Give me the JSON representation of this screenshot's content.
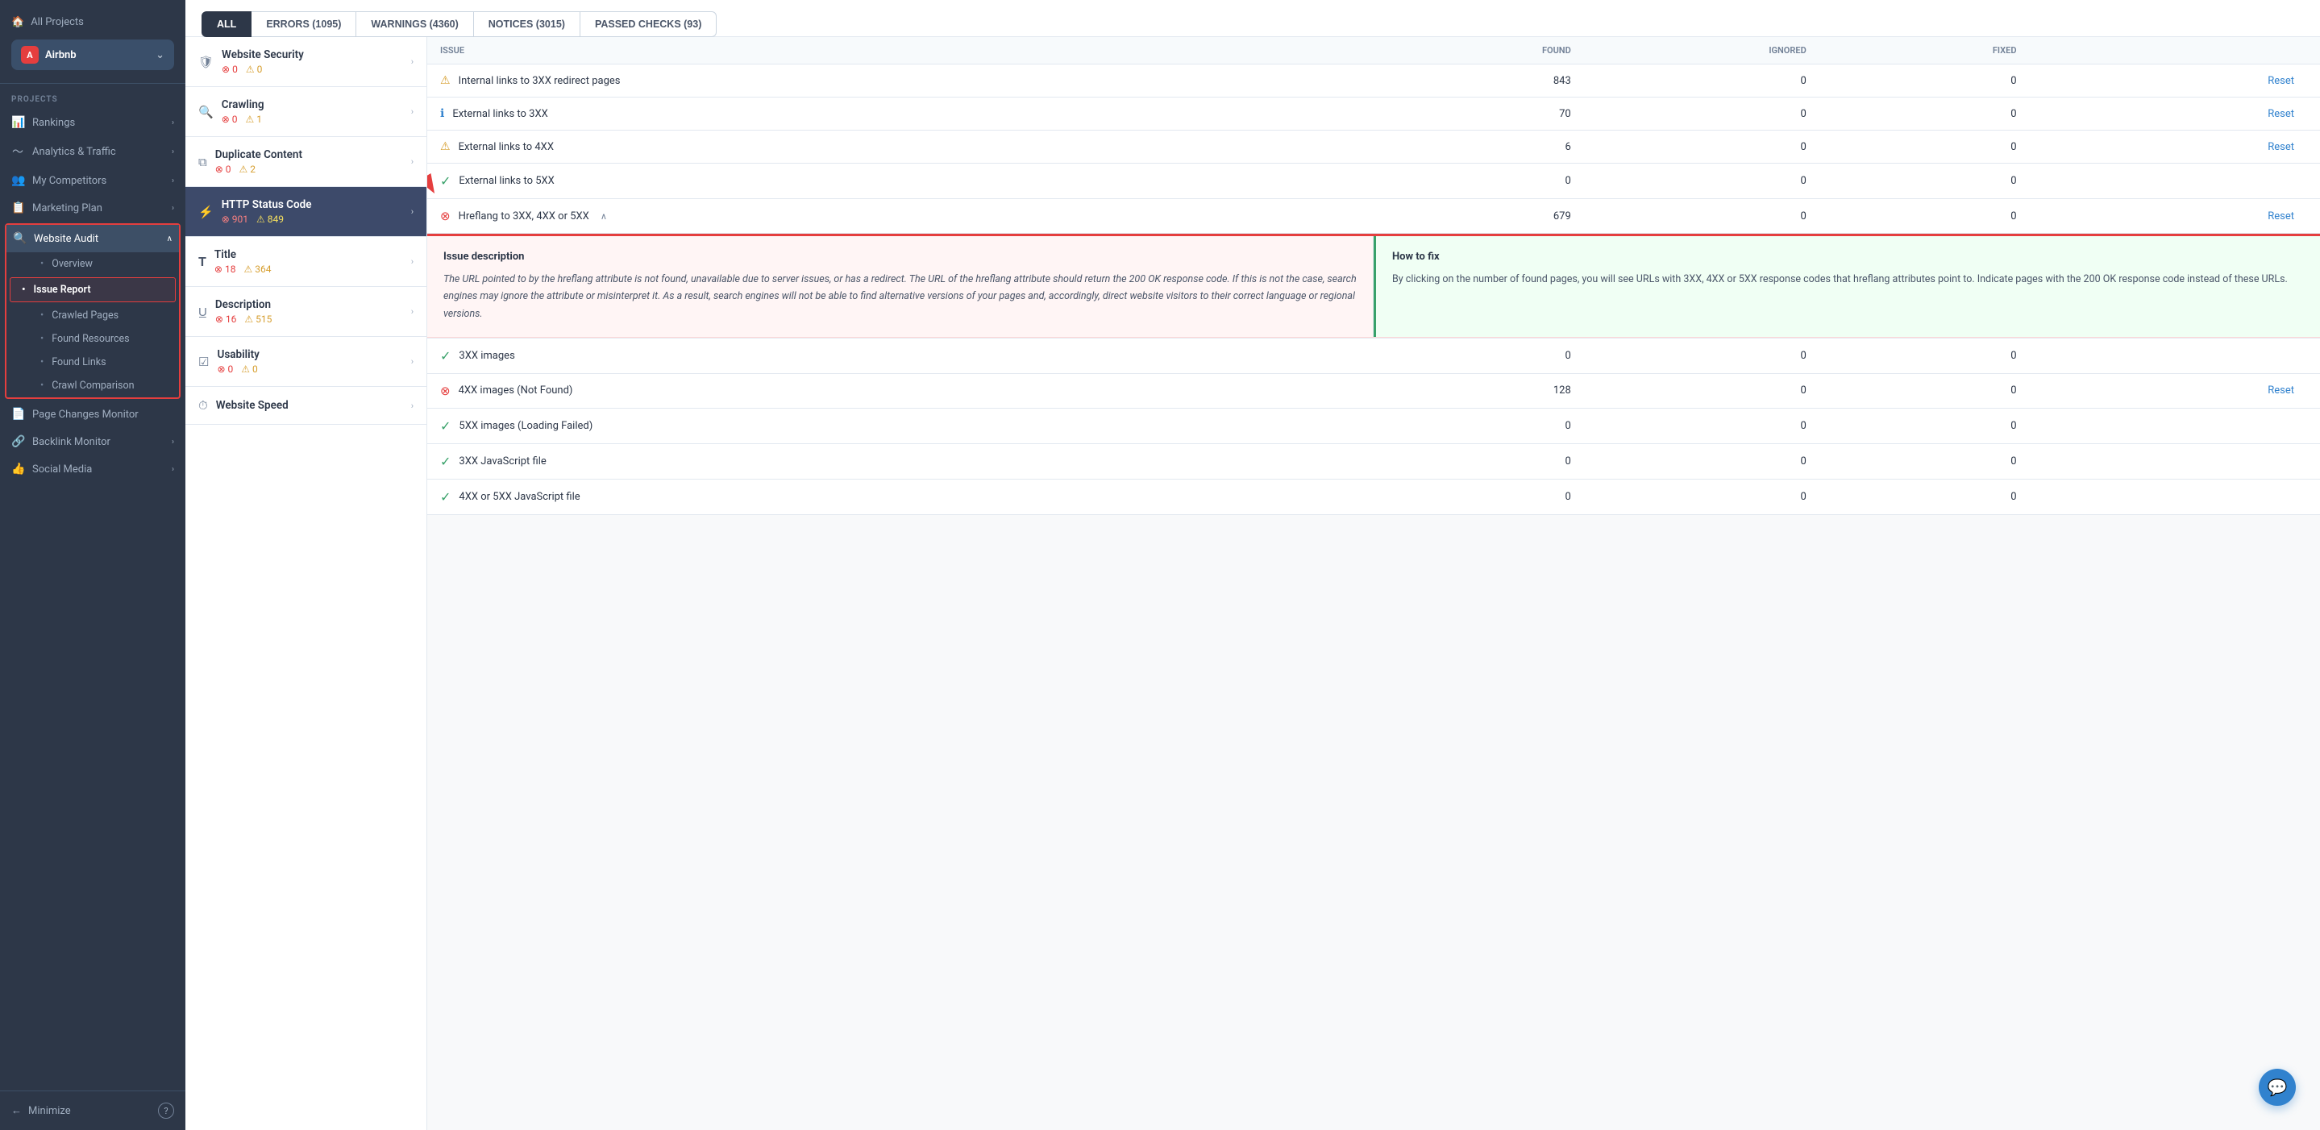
{
  "sidebar": {
    "all_projects_label": "All Projects",
    "project_icon_text": "A",
    "project_name": "Airbnb",
    "projects_section_label": "PROJECTS",
    "nav_items": [
      {
        "id": "rankings",
        "label": "Rankings",
        "icon": "📊",
        "has_chevron": true
      },
      {
        "id": "analytics",
        "label": "Analytics & Traffic",
        "icon": "〜",
        "has_chevron": true
      },
      {
        "id": "competitors",
        "label": "My Competitors",
        "icon": "👥",
        "has_chevron": true
      },
      {
        "id": "marketing",
        "label": "Marketing Plan",
        "icon": "📋",
        "has_chevron": true
      },
      {
        "id": "website-audit",
        "label": "Website Audit",
        "icon": "🔍",
        "has_chevron": true,
        "active": true
      }
    ],
    "sub_items": [
      {
        "id": "overview",
        "label": "Overview",
        "active": false
      },
      {
        "id": "issue-report",
        "label": "Issue Report",
        "active": true
      },
      {
        "id": "crawled-pages",
        "label": "Crawled Pages",
        "active": false
      },
      {
        "id": "found-resources",
        "label": "Found Resources",
        "active": false
      },
      {
        "id": "found-links",
        "label": "Found Links",
        "active": false
      },
      {
        "id": "crawl-comparison",
        "label": "Crawl Comparison",
        "active": false
      }
    ],
    "bottom_items": [
      {
        "id": "page-changes",
        "label": "Page Changes Monitor",
        "icon": "📄"
      },
      {
        "id": "backlink",
        "label": "Backlink Monitor",
        "icon": "🔗",
        "has_chevron": true
      },
      {
        "id": "social",
        "label": "Social Media",
        "icon": "👍",
        "has_chevron": true
      }
    ],
    "minimize_label": "Minimize",
    "help_icon": "?"
  },
  "filter_tabs": [
    {
      "id": "all",
      "label": "ALL",
      "active": true
    },
    {
      "id": "errors",
      "label": "ERRORS (1095)",
      "active": false
    },
    {
      "id": "warnings",
      "label": "WARNINGS (4360)",
      "active": false
    },
    {
      "id": "notices",
      "label": "NOTICES (3015)",
      "active": false
    },
    {
      "id": "passed",
      "label": "PASSED CHECKS (93)",
      "active": false
    }
  ],
  "categories": [
    {
      "id": "website-security",
      "label": "Website Security",
      "icon": "shield",
      "errors": 0,
      "warnings": 0
    },
    {
      "id": "crawling",
      "label": "Crawling",
      "icon": "search",
      "errors": 0,
      "warnings": 1
    },
    {
      "id": "duplicate-content",
      "label": "Duplicate Content",
      "icon": "copy",
      "errors": 0,
      "warnings": 2
    },
    {
      "id": "http-status",
      "label": "HTTP Status Code",
      "icon": "pulse",
      "errors": 901,
      "warnings": 849,
      "active": true
    },
    {
      "id": "title",
      "label": "Title",
      "icon": "T",
      "errors": 18,
      "warnings": 364
    },
    {
      "id": "description",
      "label": "Description",
      "icon": "underline",
      "errors": 16,
      "warnings": 515
    },
    {
      "id": "usability",
      "label": "Usability",
      "icon": "checkbox",
      "errors": 0,
      "warnings": 0
    },
    {
      "id": "website-speed",
      "label": "Website Speed",
      "icon": "gauge"
    }
  ],
  "table_columns": [
    "Issue",
    "Found",
    "Ignored",
    "Fixed",
    ""
  ],
  "issues": [
    {
      "id": "internal-links-3xx",
      "type": "warning",
      "name": "Internal links to 3XX redirect pages",
      "found": 843,
      "ignored": 0,
      "fixed": 0,
      "has_reset": true
    },
    {
      "id": "external-links-3xx",
      "type": "info",
      "name": "External links to 3XX",
      "found": 70,
      "ignored": 0,
      "fixed": 0,
      "has_reset": true
    },
    {
      "id": "external-links-4xx",
      "type": "warning",
      "name": "External links to 4XX",
      "found": 6,
      "ignored": 0,
      "fixed": 0,
      "has_reset": true
    },
    {
      "id": "external-links-5xx",
      "type": "passed",
      "name": "External links to 5XX",
      "found": 0,
      "ignored": 0,
      "fixed": 0,
      "has_reset": false
    },
    {
      "id": "hreflang-3xx-4xx-5xx",
      "type": "error",
      "name": "Hreflang to 3XX, 4XX or 5XX",
      "found": 679,
      "ignored": 0,
      "fixed": 0,
      "has_reset": true,
      "expanded": true,
      "has_caret": true
    }
  ],
  "expanded_issue": {
    "desc_title": "Issue description",
    "desc_text": "The URL pointed to by the hreflang attribute is not found, unavailable due to server issues, or has a redirect. The URL of the hreflang attribute should return the 200 OK response code. If this is not the case, search engines may ignore the attribute or misinterpret it. As a result, search engines will not be able to find alternative versions of your pages and, accordingly, direct website visitors to their correct language or regional versions.",
    "fix_title": "How to fix",
    "fix_text": "By clicking on the number of found pages, you will see URLs with 3XX, 4XX or 5XX response codes that hreflang attributes point to. Indicate pages with the 200 OK response code instead of these URLs."
  },
  "issues_after_expanded": [
    {
      "id": "3xx-images",
      "type": "passed",
      "name": "3XX images",
      "found": 0,
      "ignored": 0,
      "fixed": 0,
      "has_reset": false
    },
    {
      "id": "4xx-images",
      "type": "error",
      "name": "4XX images (Not Found)",
      "found": 128,
      "ignored": 0,
      "fixed": 0,
      "has_reset": false
    },
    {
      "id": "5xx-images",
      "type": "passed",
      "name": "5XX images (Loading Failed)",
      "found": 0,
      "ignored": 0,
      "fixed": 0,
      "has_reset": false
    },
    {
      "id": "3xx-js",
      "type": "passed",
      "name": "3XX JavaScript file",
      "found": 0,
      "ignored": 0,
      "fixed": 0,
      "has_reset": false
    },
    {
      "id": "4xx-5xx-js",
      "type": "passed",
      "name": "4XX or 5XX JavaScript file",
      "found": 0,
      "ignored": 0,
      "fixed": 0,
      "has_reset": false
    }
  ],
  "chat_icon": "💬"
}
